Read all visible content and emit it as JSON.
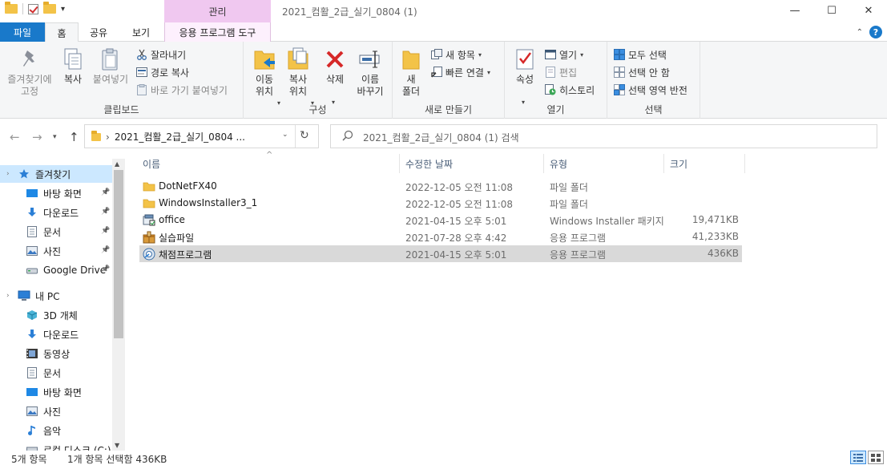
{
  "window": {
    "title": "2021_컴활_2급_실기_0804 (1)",
    "context_tab_title": "관리",
    "minimize": "—",
    "maximize": "☐",
    "close": "✕"
  },
  "tabs": {
    "file": "파일",
    "home": "홈",
    "share": "공유",
    "view": "보기",
    "app_tools": "응용 프로그램 도구"
  },
  "ribbon": {
    "clipboard": {
      "label": "클립보드",
      "pin_quick": "즐겨찾기에\n고정",
      "copy": "복사",
      "paste": "붙여넣기",
      "cut": "잘라내기",
      "copy_path": "경로 복사",
      "paste_shortcut": "바로 가기 붙여넣기"
    },
    "organize": {
      "label": "구성",
      "move_to": "이동\n위치",
      "copy_to": "복사\n위치",
      "delete": "삭제",
      "rename": "이름\n바꾸기"
    },
    "new": {
      "label": "새로 만들기",
      "new_folder": "새\n폴더",
      "new_item": "새 항목",
      "easy_access": "빠른 연결"
    },
    "open": {
      "label": "열기",
      "properties": "속성",
      "open": "열기",
      "edit": "편집",
      "history": "히스토리"
    },
    "select": {
      "label": "선택",
      "select_all": "모두 선택",
      "select_none": "선택 안 함",
      "invert": "선택 영역 반전"
    }
  },
  "address": {
    "path": "2021_컴활_2급_실기_0804 ...",
    "search_placeholder": "2021_컴활_2급_실기_0804 (1) 검색"
  },
  "nav_pane": {
    "items": [
      {
        "label": "즐겨찾기",
        "icon": "star-icon",
        "pinned": false
      },
      {
        "label": "바탕 화면",
        "icon": "desktop-icon",
        "pinned": true
      },
      {
        "label": "다운로드",
        "icon": "download-icon",
        "pinned": true
      },
      {
        "label": "문서",
        "icon": "document-icon",
        "pinned": true
      },
      {
        "label": "사진",
        "icon": "picture-icon",
        "pinned": true
      },
      {
        "label": "Google Drive",
        "icon": "drive-icon",
        "pinned": true
      },
      {
        "label": "내 PC",
        "icon": "pc-icon",
        "pinned": false
      },
      {
        "label": "3D 개체",
        "icon": "cube-icon",
        "pinned": false
      },
      {
        "label": "다운로드",
        "icon": "download-icon",
        "pinned": false
      },
      {
        "label": "동영상",
        "icon": "video-icon",
        "pinned": false
      },
      {
        "label": "문서",
        "icon": "document-icon",
        "pinned": false
      },
      {
        "label": "바탕 화면",
        "icon": "desktop-icon",
        "pinned": false
      },
      {
        "label": "사진",
        "icon": "picture-icon",
        "pinned": false
      },
      {
        "label": "음악",
        "icon": "music-icon",
        "pinned": false
      },
      {
        "label": "로컬 디스크 (C:)",
        "icon": "disk-icon",
        "pinned": false
      }
    ]
  },
  "file_list": {
    "columns": {
      "name": "이름",
      "date": "수정한 날짜",
      "type": "유형",
      "size": "크기"
    },
    "rows": [
      {
        "name": "DotNetFX40",
        "date": "2022-12-05 오전 11:08",
        "type": "파일 폴더",
        "size": "",
        "icon": "folder-icon"
      },
      {
        "name": "WindowsInstaller3_1",
        "date": "2022-12-05 오전 11:08",
        "type": "파일 폴더",
        "size": "",
        "icon": "folder-icon"
      },
      {
        "name": "office",
        "date": "2021-04-15 오후 5:01",
        "type": "Windows Installer 패키지",
        "size": "19,471KB",
        "icon": "installer-icon"
      },
      {
        "name": "실습파일",
        "date": "2021-07-28 오후 4:42",
        "type": "응용 프로그램",
        "size": "41,233KB",
        "icon": "archive-exe-icon"
      },
      {
        "name": "채점프로그램",
        "date": "2021-04-15 오후 5:01",
        "type": "응용 프로그램",
        "size": "436KB",
        "icon": "setup-exe-icon"
      }
    ]
  },
  "status": {
    "count": "5개 항목",
    "selection": "1개 항목 선택함 436KB"
  },
  "colors": {
    "accent": "#1979ca",
    "selected_row": "#d9d9d9",
    "nav_selected": "#cce8ff",
    "context_tab": "#f0c8f0"
  }
}
